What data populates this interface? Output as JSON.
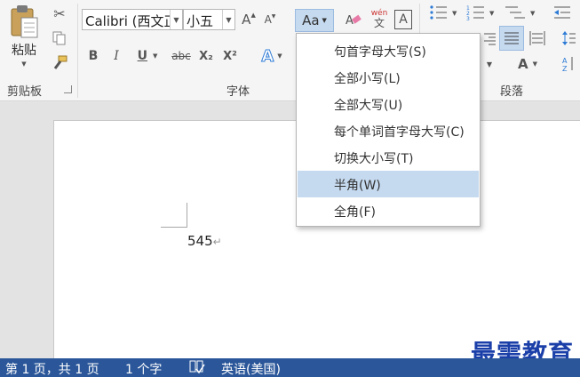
{
  "ribbon": {
    "clipboard": {
      "paste_label": "粘贴",
      "group_label": "剪贴板"
    },
    "font": {
      "font_name": "Calibri (西文正文)",
      "font_size": "小五",
      "grow_font": "A",
      "shrink_font": "A",
      "change_case": "Aa",
      "phonetic_top": "wén",
      "phonetic_bottom": "文",
      "char_border": "A",
      "bold": "B",
      "italic": "I",
      "underline": "U",
      "strikethrough": "abc",
      "subscript": "X₂",
      "superscript": "X²",
      "text_effects": "A",
      "group_label": "字体"
    },
    "paragraph": {
      "group_label": "段落",
      "char_effect": "A"
    }
  },
  "document": {
    "text": "545",
    "paragraph_mark": "↵"
  },
  "change_case_menu": {
    "items": [
      "句首字母大写(S)",
      "全部小写(L)",
      "全部大写(U)",
      "每个单词首字母大写(C)",
      "切换大小写(T)",
      "半角(W)",
      "全角(F)"
    ],
    "highlighted_index": 5
  },
  "status": {
    "page": "第 1 页，共 1 页",
    "words": "1 个字",
    "language": "英语(美国)"
  },
  "watermark": "最需教育",
  "colors": {
    "statusbar": "#2b579a",
    "menu_highlight": "#c5d9ef",
    "watermark": "#1b3fa8"
  }
}
